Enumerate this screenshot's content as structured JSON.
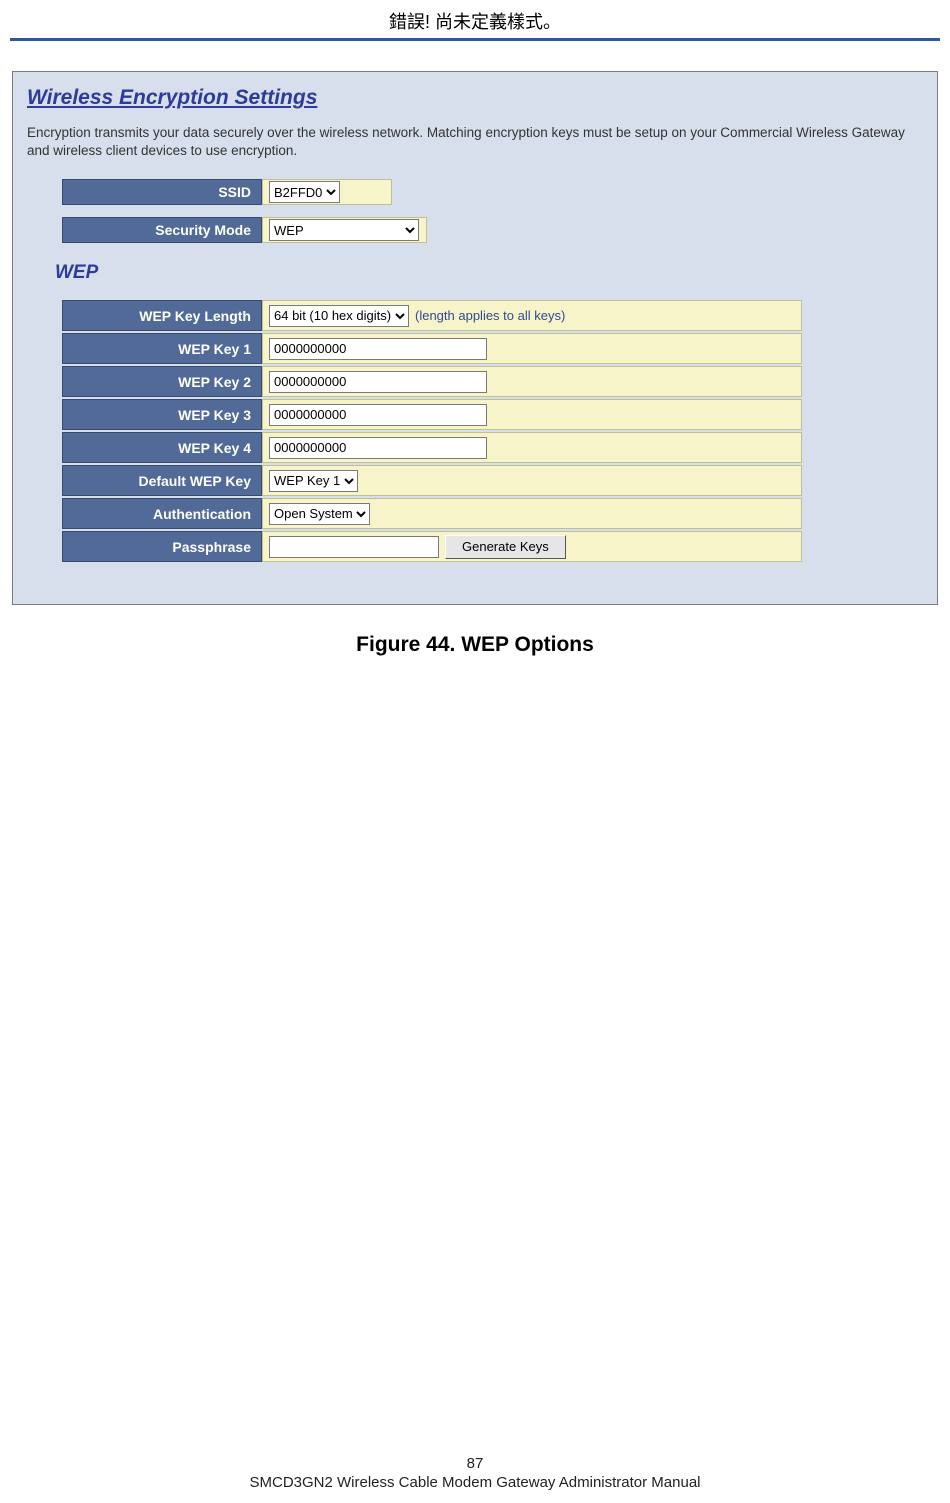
{
  "header": "錯誤! 尚未定義樣式。",
  "panel": {
    "title": "Wireless Encryption Settings",
    "description": "Encryption transmits your data securely over the wireless network. Matching encryption keys must be setup on your Commercial Wireless Gateway and wireless client devices to use encryption.",
    "ssid_label": "SSID",
    "ssid_value": "B2FFD0",
    "security_mode_label": "Security Mode",
    "security_mode_value": "WEP",
    "section_title": "WEP",
    "wep_key_length_label": "WEP Key Length",
    "wep_key_length_value": "64 bit (10 hex digits)",
    "wep_key_length_hint": "(length applies to all keys)",
    "wep_key1_label": "WEP Key 1",
    "wep_key1_value": "0000000000",
    "wep_key2_label": "WEP Key 2",
    "wep_key2_value": "0000000000",
    "wep_key3_label": "WEP Key 3",
    "wep_key3_value": "0000000000",
    "wep_key4_label": "WEP Key 4",
    "wep_key4_value": "0000000000",
    "default_wep_key_label": "Default WEP Key",
    "default_wep_key_value": "WEP Key 1",
    "authentication_label": "Authentication",
    "authentication_value": "Open System",
    "passphrase_label": "Passphrase",
    "passphrase_value": "",
    "generate_keys_label": "Generate Keys"
  },
  "figure_caption": "Figure 44. WEP Options",
  "footer": {
    "page_number": "87",
    "manual_title": "SMCD3GN2 Wireless Cable Modem Gateway Administrator Manual"
  }
}
